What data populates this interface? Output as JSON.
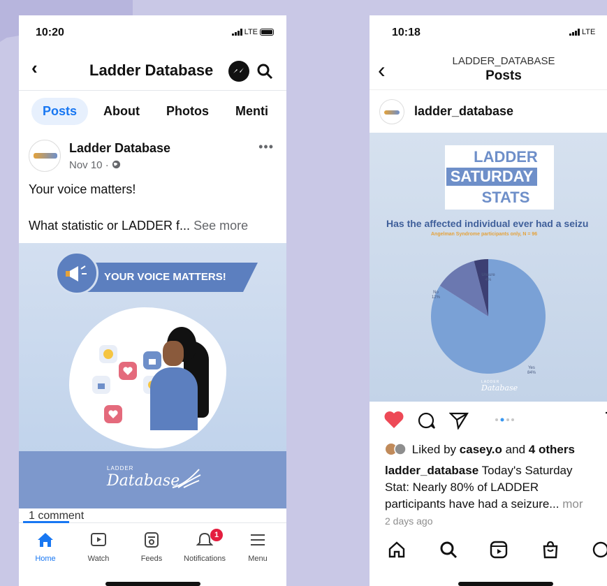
{
  "facebook": {
    "status": {
      "time": "10:20",
      "network": "LTE"
    },
    "header": {
      "title": "Ladder Database"
    },
    "tabs": [
      "Posts",
      "About",
      "Photos",
      "Menti"
    ],
    "post": {
      "author": "Ladder Database",
      "date": "Nov 10 ·",
      "line1": "Your voice matters!",
      "line2": "What statistic or LADDER f...",
      "see_more": "See more",
      "banner": "YOUR VOICE MATTERS!",
      "logo_small": "LADDER",
      "logo": "Database"
    },
    "comment_text": "1 comment",
    "nav": [
      {
        "label": "Home",
        "icon": "home-icon"
      },
      {
        "label": "Watch",
        "icon": "watch-icon"
      },
      {
        "label": "Feeds",
        "icon": "feeds-icon"
      },
      {
        "label": "Notifications",
        "icon": "bell-icon",
        "badge": "1"
      },
      {
        "label": "Menu",
        "icon": "menu-icon"
      }
    ],
    "colors": {
      "accent": "#1877f2",
      "badge": "#e41e3f"
    }
  },
  "instagram": {
    "status": {
      "time": "10:18",
      "network": "LTE"
    },
    "header": {
      "subtitle": "LADDER_DATABASE",
      "title": "Posts"
    },
    "username": "ladder_database",
    "post_image": {
      "title_line1": "LADDER",
      "title_line2": "SATURDAY",
      "title_line3": "STATS",
      "question": "Has the affected individual ever had a seizu",
      "subquestion": "Angelman Syndrome participants only, N = 96",
      "logo_small": "LADDER",
      "logo": "Database"
    },
    "likes": {
      "prefix": "Liked by",
      "user": "casey.o",
      "joiner": "and",
      "others": "4 others"
    },
    "caption": {
      "user": "ladder_database",
      "line1": "Today's Saturday",
      "line2": "Stat: Nearly 80% of LADDER",
      "line3": "participants have had a seizure...",
      "more": "mor"
    },
    "time_ago": "2 days ago",
    "colors": {
      "like": "#ed4956",
      "chart_yes": "#7aa1d6",
      "chart_no": "#6b78b0",
      "chart_unsure": "#3c3f73"
    }
  },
  "chart_data": {
    "type": "pie",
    "title": "Has the affected individual ever had a seizu",
    "subtitle": "Angelman Syndrome participants only, N = 96",
    "categories": [
      "Yes",
      "No",
      "Unsure"
    ],
    "values": [
      84,
      12,
      4
    ],
    "labels": [
      "Yes\n84%",
      "No\n12%",
      "Unsure\n4%"
    ]
  }
}
